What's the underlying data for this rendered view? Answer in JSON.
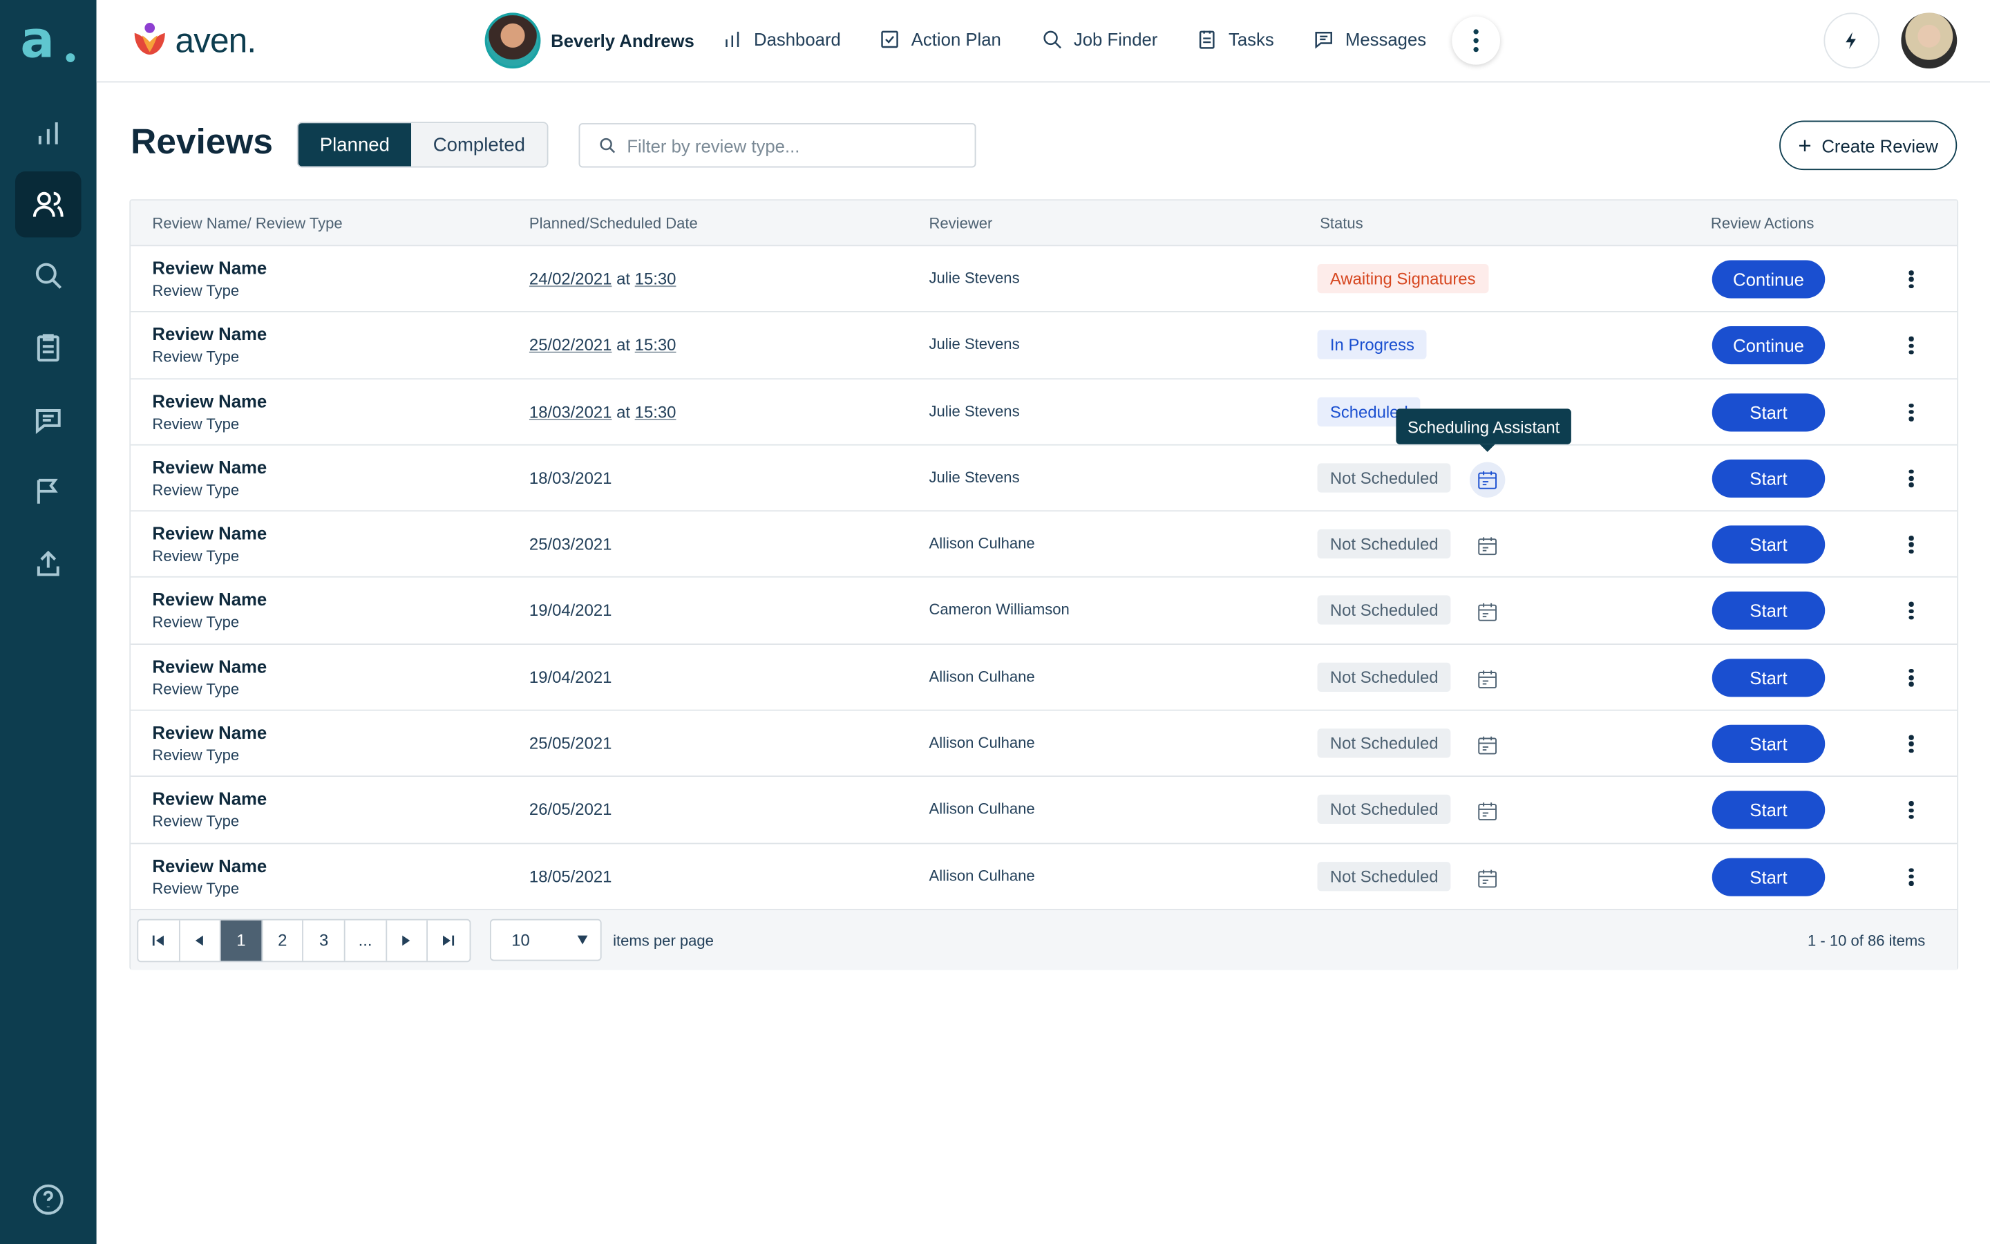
{
  "app": {
    "brand_letter": "a",
    "logo_word": "aven."
  },
  "topbar": {
    "user_name": "Beverly Andrews",
    "nav": [
      {
        "label": "Dashboard",
        "icon": "bar-chart-icon"
      },
      {
        "label": "Action Plan",
        "icon": "checkbox-icon"
      },
      {
        "label": "Job Finder",
        "icon": "search-icon"
      },
      {
        "label": "Tasks",
        "icon": "clipboard-icon"
      },
      {
        "label": "Messages",
        "icon": "chat-icon"
      }
    ]
  },
  "page": {
    "title": "Reviews",
    "tabs": {
      "planned": "Planned",
      "completed": "Completed"
    },
    "filter_placeholder": "Filter by review type...",
    "create_label": "Create Review"
  },
  "table": {
    "headers": {
      "name": "Review Name/ Review Type",
      "date": "Planned/Scheduled  Date",
      "reviewer": "Reviewer",
      "status": "Status",
      "actions": "Review Actions"
    },
    "rows": [
      {
        "name": "Review Name",
        "type": "Review Type",
        "date": "24/02/2021",
        "at": "at",
        "time": "15:30",
        "reviewer": "Julie Stevens",
        "status": "Awaiting Signatures",
        "action": "Continue"
      },
      {
        "name": "Review Name",
        "type": "Review Type",
        "date": "25/02/2021",
        "at": "at",
        "time": "15:30",
        "reviewer": "Julie Stevens",
        "status": "In Progress",
        "action": "Continue"
      },
      {
        "name": "Review Name",
        "type": "Review Type",
        "date": "18/03/2021",
        "at": "at",
        "time": "15:30",
        "reviewer": "Julie Stevens",
        "status": "Scheduled",
        "action": "Start"
      },
      {
        "name": "Review Name",
        "type": "Review Type",
        "date": "18/03/2021",
        "reviewer": "Julie Stevens",
        "status": "Not Scheduled",
        "action": "Start"
      },
      {
        "name": "Review Name",
        "type": "Review Type",
        "date": "25/03/2021",
        "reviewer": "Allison Culhane",
        "status": "Not Scheduled",
        "action": "Start"
      },
      {
        "name": "Review Name",
        "type": "Review Type",
        "date": "19/04/2021",
        "reviewer": "Cameron Williamson",
        "status": "Not Scheduled",
        "action": "Start"
      },
      {
        "name": "Review Name",
        "type": "Review Type",
        "date": "19/04/2021",
        "reviewer": "Allison Culhane",
        "status": "Not Scheduled",
        "action": "Start"
      },
      {
        "name": "Review Name",
        "type": "Review Type",
        "date": "25/05/2021",
        "reviewer": "Allison Culhane",
        "status": "Not Scheduled",
        "action": "Start"
      },
      {
        "name": "Review Name",
        "type": "Review Type",
        "date": "26/05/2021",
        "reviewer": "Allison Culhane",
        "status": "Not Scheduled",
        "action": "Start"
      },
      {
        "name": "Review Name",
        "type": "Review Type",
        "date": "18/05/2021",
        "reviewer": "Allison Culhane",
        "status": "Not Scheduled",
        "action": "Start"
      }
    ],
    "tooltip": "Scheduling Assistant"
  },
  "pager": {
    "pages": [
      "1",
      "2",
      "3",
      "..."
    ],
    "current": "1",
    "per_page": "10",
    "per_page_label": "items per page",
    "range": "1 - 10 of 86 items"
  },
  "colors": {
    "rail": "#0d3d4f",
    "primary": "#1a4fd0",
    "awaiting": "#d6461f"
  }
}
